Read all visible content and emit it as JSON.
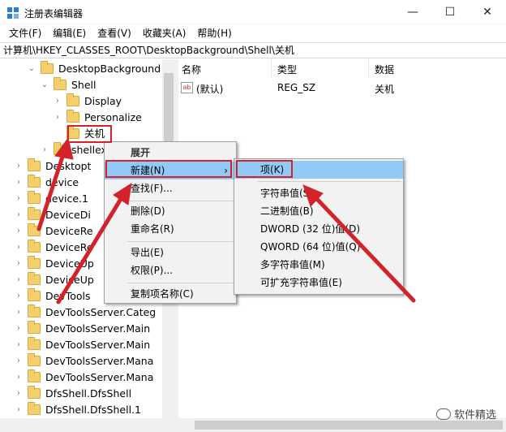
{
  "window": {
    "title": "注册表编辑器",
    "controls": {
      "minimize": "—",
      "maximize": "☐",
      "close": "✕"
    }
  },
  "menu": [
    "文件(F)",
    "编辑(E)",
    "查看(V)",
    "收藏夹(A)",
    "帮助(H)"
  ],
  "address": "计算机\\HKEY_CLASSES_ROOT\\DesktopBackground\\Shell\\关机",
  "tree": [
    {
      "label": "DesktopBackground",
      "chev": "⌄"
    },
    {
      "label": "Shell",
      "chev": "⌄"
    },
    {
      "label": "Display",
      "chev": "›"
    },
    {
      "label": "Personalize",
      "chev": "›"
    },
    {
      "label": "关机",
      "chev": ""
    },
    {
      "label": "shellex",
      "chev": "›"
    },
    {
      "label": "Desktopt",
      "chev": "›"
    },
    {
      "label": "device",
      "chev": "›"
    },
    {
      "label": "device.1",
      "chev": "›"
    },
    {
      "label": "DeviceDi",
      "chev": "›"
    },
    {
      "label": "DeviceRe",
      "chev": "›"
    },
    {
      "label": "DeviceRe",
      "chev": "›"
    },
    {
      "label": "DeviceUp",
      "chev": "›"
    },
    {
      "label": "DeviceUp",
      "chev": "›"
    },
    {
      "label": "DevTools",
      "chev": "›"
    },
    {
      "label": "DevToolsServer.Categ",
      "chev": "›"
    },
    {
      "label": "DevToolsServer.Main",
      "chev": "›"
    },
    {
      "label": "DevToolsServer.Main",
      "chev": "›"
    },
    {
      "label": "DevToolsServer.Mana",
      "chev": "›"
    },
    {
      "label": "DevToolsServer.Mana",
      "chev": "›"
    },
    {
      "label": "DfsShell.DfsShell",
      "chev": "›"
    },
    {
      "label": "DfsShell.DfsShell.1",
      "chev": "›"
    }
  ],
  "columns": {
    "name": "名称",
    "type": "类型",
    "data": "数据"
  },
  "values": [
    {
      "icon": "ab",
      "name": "(默认)",
      "type": "REG_SZ",
      "data": "关机"
    }
  ],
  "context_menu": {
    "header": "展开",
    "items": [
      "新建(N)",
      "查找(F)...",
      "删除(D)",
      "重命名(R)",
      "导出(E)",
      "权限(P)...",
      "复制项名称(C)"
    ],
    "arrow": "›"
  },
  "submenu": {
    "items": [
      "项(K)",
      "字符串值(S)",
      "二进制值(B)",
      "DWORD (32 位)值(D)",
      "QWORD (64 位)值(Q)",
      "多字符串值(M)",
      "可扩充字符串值(E)"
    ]
  },
  "watermark": "软件精选",
  "colors": {
    "highlight": "#91c9f7",
    "annotation": "#d2232a",
    "folder": "#f4cf6a"
  }
}
